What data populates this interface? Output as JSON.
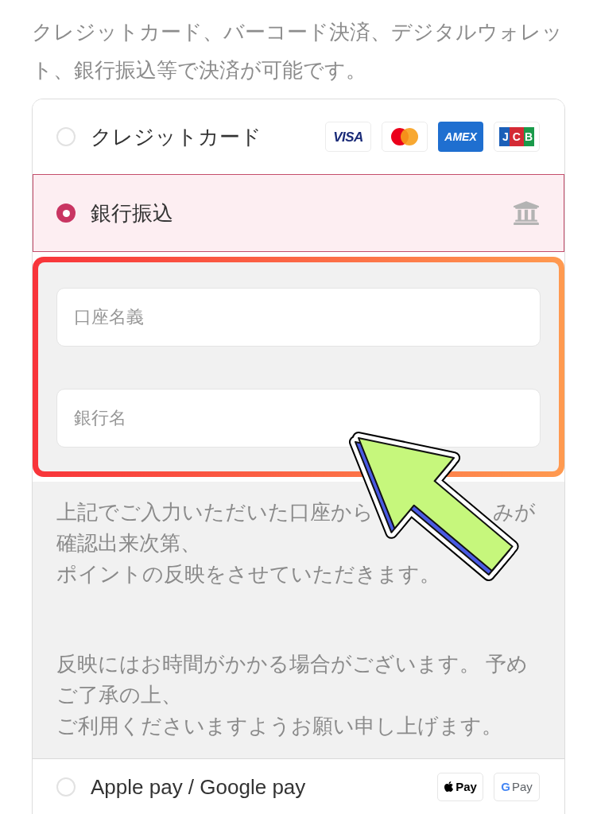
{
  "intro": "クレジットカード、バーコード決済、デジタルウォレット、銀行振込等で決済が可能です。",
  "methods": [
    {
      "kind": "card",
      "label": "クレジットカード",
      "selected": false,
      "logos": [
        {
          "kind": "visa",
          "text": "VISA"
        },
        {
          "kind": "mastercard"
        },
        {
          "kind": "amex",
          "text": "AMEX"
        },
        {
          "kind": "jcb",
          "text": "JCB"
        }
      ]
    },
    {
      "kind": "bank",
      "label": "銀行振込",
      "selected": true,
      "fields": [
        {
          "placeholder": "口座名義"
        },
        {
          "placeholder": "銀行名"
        }
      ],
      "notes": [
        {
          "lines": [
            {
              "parts": [
                "上記でご入力いただいた口座から",
                "みが"
              ]
            },
            {
              "parts": [
                "確認出来次第、"
              ]
            },
            {
              "parts": [
                "ポイントの反映をさせていただきます。"
              ]
            }
          ]
        },
        {
          "lines": [
            {
              "parts": [
                "反映にはお時間がかかる場合がございます。 予め"
              ]
            },
            {
              "parts": [
                "ご了承の上、"
              ]
            },
            {
              "parts": [
                "ご利用くださいますようお願い申し上げます。"
              ]
            }
          ]
        }
      ]
    },
    {
      "kind": "wallet",
      "label": "Apple pay / Google pay",
      "selected": false,
      "logos": [
        {
          "kind": "apple_pay",
          "text": "Pay"
        },
        {
          "kind": "google_pay",
          "mark": "G",
          "text": "Pay"
        }
      ]
    }
  ]
}
